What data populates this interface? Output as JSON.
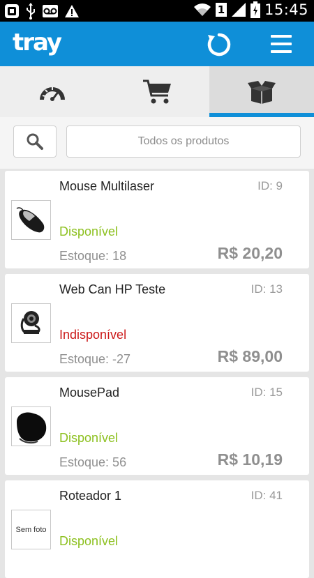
{
  "status_bar": {
    "time": "15:45",
    "sim_indicator": "1",
    "icons": [
      "qr-icon",
      "usb-icon",
      "voicemail-icon",
      "warning-icon",
      "wifi-icon",
      "signal-icon",
      "battery-icon"
    ]
  },
  "app_bar": {
    "logo_text": "tray",
    "refresh_icon": "refresh-icon",
    "menu_icon": "menu-icon"
  },
  "tabs": [
    {
      "icon": "dashboard-icon",
      "active": false
    },
    {
      "icon": "cart-icon",
      "active": false
    },
    {
      "icon": "box-icon",
      "active": true
    }
  ],
  "filter": {
    "search_icon": "search-icon",
    "label": "Todos os produtos"
  },
  "products": [
    {
      "name": "Mouse Multilaser",
      "id": "ID: 9",
      "status": "Disponível",
      "status_color": "#8cc01e",
      "stock": "Estoque: 18",
      "price": "R$ 20,20",
      "thumb": "mouse-image"
    },
    {
      "name": "Web Can HP Teste",
      "id": "ID: 13",
      "status": "Indisponível",
      "status_color": "#cc1a1a",
      "stock": "Estoque: -27",
      "price": "R$ 89,00",
      "thumb": "webcam-image"
    },
    {
      "name": "MousePad",
      "id": "ID: 15",
      "status": "Disponível",
      "status_color": "#8cc01e",
      "stock": "Estoque: 56",
      "price": "R$ 10,19",
      "thumb": "mousepad-image"
    },
    {
      "name": "Roteador 1",
      "id": "ID: 41",
      "status": "Disponível",
      "status_color": "#8cc01e",
      "stock": "",
      "price": "",
      "thumb_text": "Sem foto"
    }
  ],
  "colors": {
    "brand": "#0f8fd8",
    "available": "#8cc01e",
    "unavailable": "#cc1a1a"
  }
}
